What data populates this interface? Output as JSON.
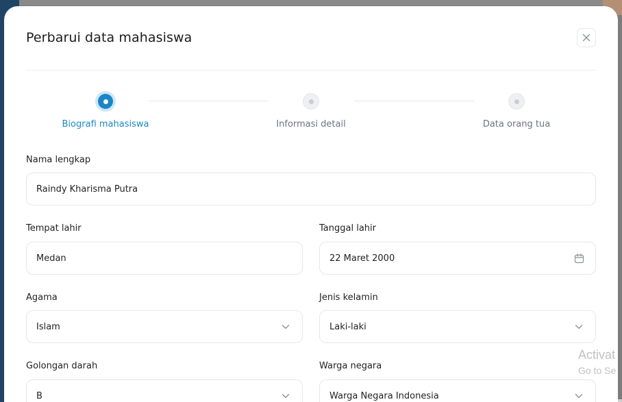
{
  "modal": {
    "title": "Perbarui data mahasiswa",
    "close_icon": "close-icon"
  },
  "stepper": {
    "steps": [
      {
        "label": "Biografi mahasiswa",
        "state": "active"
      },
      {
        "label": "Informasi detail",
        "state": "inactive"
      },
      {
        "label": "Data orang tua",
        "state": "inactive"
      }
    ]
  },
  "form": {
    "nama_lengkap": {
      "label": "Nama lengkap",
      "value": "Raindy Kharisma Putra"
    },
    "tempat_lahir": {
      "label": "Tempat lahir",
      "value": "Medan"
    },
    "tanggal_lahir": {
      "label": "Tanggal lahir",
      "value": "22 Maret 2000",
      "icon": "calendar-icon"
    },
    "agama": {
      "label": "Agama",
      "value": "Islam",
      "icon": "chevron-down-icon"
    },
    "jenis_kelamin": {
      "label": "Jenis kelamin",
      "value": "Laki-laki",
      "icon": "chevron-down-icon"
    },
    "golongan_darah": {
      "label": "Golongan darah",
      "value": "B",
      "icon": "chevron-down-icon"
    },
    "warga_negara": {
      "label": "Warga negara",
      "value": "Warga Negara Indonesia",
      "icon": "chevron-down-icon"
    }
  },
  "watermark": {
    "line1": "Activat",
    "line2": "Go to Se"
  },
  "colors": {
    "accent": "#1a86c7",
    "accent_soft": "#cfe6f5",
    "border": "#e5e7eb",
    "backdrop": "#7c7c7c",
    "sidebar": "#1f4466"
  }
}
